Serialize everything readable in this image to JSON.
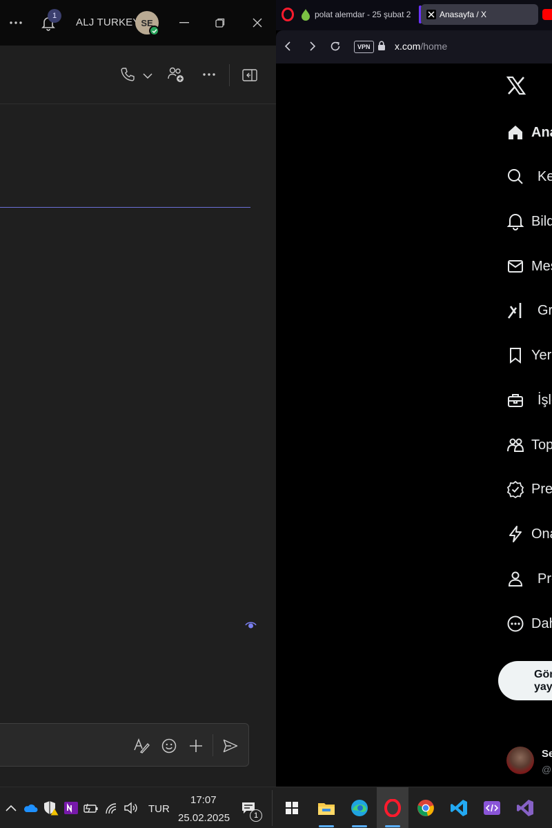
{
  "teams": {
    "account_name": "ALJ TURKEY",
    "avatar_initials": "SE",
    "notification_count": "1",
    "icons": [
      "more-icon",
      "bell-icon",
      "minimize-icon",
      "restore-icon",
      "close-icon",
      "phone-icon",
      "chevron-down-icon",
      "add-people-icon",
      "more-options-icon",
      "open-panel-icon",
      "eye-icon",
      "format-icon",
      "emoji-icon",
      "plus-icon",
      "send-icon"
    ],
    "colors": {
      "accent": "#6b70d8",
      "presence": "#27a35a",
      "background": "#1f1f1f"
    }
  },
  "browser": {
    "tabs": [
      {
        "label": "polat alemdar - 25 şubat 2"
      },
      {
        "label": "Anasayfa / X"
      }
    ],
    "url_vpn_badge": "VPN",
    "url_host": "x.com",
    "url_path": "/home"
  },
  "x_app": {
    "nav": [
      {
        "id": "home",
        "label": "Anasayfa",
        "icon": "home-icon"
      },
      {
        "id": "explore",
        "label": "Keşfet",
        "icon": "search-icon"
      },
      {
        "id": "notifications",
        "label": "Bildirimler",
        "icon": "bell-icon"
      },
      {
        "id": "messages",
        "label": "Mesajlar",
        "icon": "mail-icon"
      },
      {
        "id": "grok",
        "label": "Grok",
        "icon": "grok-icon"
      },
      {
        "id": "bookmarks",
        "label": "Yer işaretleri",
        "icon": "bookmark-icon"
      },
      {
        "id": "jobs",
        "label": "İşler",
        "icon": "briefcase-icon"
      },
      {
        "id": "communities",
        "label": "Topluluklar",
        "icon": "people-icon"
      },
      {
        "id": "premium",
        "label": "Premium",
        "icon": "verified-icon"
      },
      {
        "id": "verified-orgs",
        "label": "Onaylı Kuruluşlar",
        "icon": "lightning-icon"
      },
      {
        "id": "profile",
        "label": "Profil",
        "icon": "person-icon"
      },
      {
        "id": "more",
        "label": "Daha fazla",
        "icon": "more-circle-icon"
      }
    ],
    "post_button_label": "Gönderi yayınla",
    "profile_name": "Se",
    "profile_handle": "@s"
  },
  "taskbar": {
    "language": "TUR",
    "time": "17:07",
    "date": "25.02.2025",
    "notification_count": "1",
    "apps": [
      "windows-start-icon",
      "file-explorer-icon",
      "edge-icon",
      "opera-icon",
      "chrome-icon",
      "vscode-icon",
      "dev-tools-icon",
      "visual-studio-icon"
    ]
  }
}
